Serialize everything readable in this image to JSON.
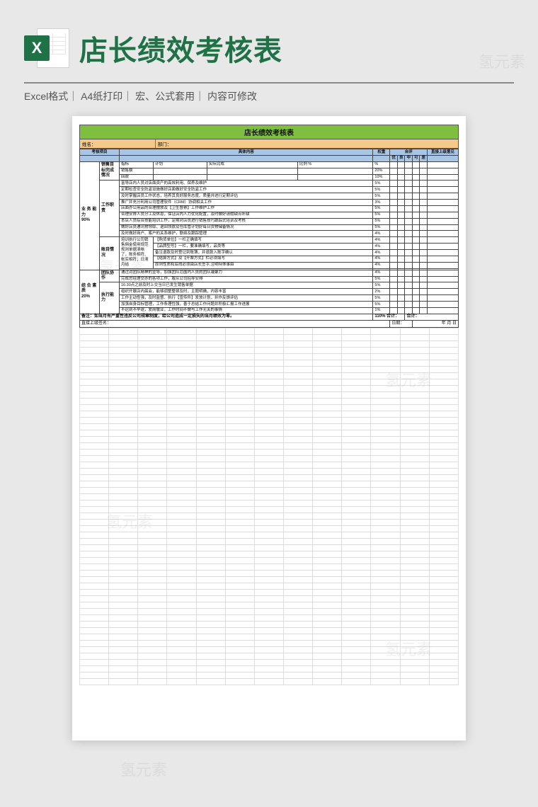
{
  "header": {
    "title": "店长绩效考核表",
    "excel_letter": "X"
  },
  "meta": {
    "line": "Excel格式｜  A4纸打印｜ 宏、公式套用｜ 内容可修改"
  },
  "sheet": {
    "title": "店长绩效考核表",
    "name_label": "姓名：",
    "dept_label": "部门：",
    "col": {
      "item": "考核项目",
      "content": "具体内容",
      "weight": "权重",
      "self": "自评",
      "self_sub": [
        "优",
        "良",
        "中",
        "可",
        "差"
      ],
      "supervisor": "直接上级意见"
    },
    "cat1": {
      "label": "业 务 能 力",
      "weight": "90%"
    },
    "cat2": {
      "label": "综 合 素 质",
      "weight": "20%"
    },
    "g1": {
      "label": "销售目标完成情况",
      "r1a": "指标",
      "r1b": "计划",
      "r1c": "实际完成",
      "r1d": "比例 %",
      "r1w": "%",
      "r2": "销售额",
      "r2w": "20%",
      "r3": "回款",
      "r3w": "10%"
    },
    "g2": {
      "label": "工作职责",
      "rows": [
        {
          "t": "富导店内人员对店面资产的高效利用、保养及维护",
          "w": "5%"
        },
        {
          "t": "定期检查安全防盗设施做好店面做好安全防盗工作",
          "w": "5%"
        },
        {
          "t": "及时掌握店员工作状态，培养其良好服务态度、质量并进行定期评估",
          "w": "5%"
        },
        {
          "t": "推广并充分利用公司管理软件（CRM）协调相关工作",
          "w": "3%"
        },
        {
          "t": "店面办公用品的合理摆放及【卫生督察】工作维护工作",
          "w": "5%"
        },
        {
          "t": "合理安排人员分工及休息，保证店内人力优化配置，及时做好请假缺点补缺",
          "w": "5%"
        },
        {
          "t": "本店人员综合技能培训工作，定期对店员进行销售技巧跟踪式培训及考核",
          "w": "5%"
        },
        {
          "t": "做好店员通讯物领取、退回领款及仓库管计划好每日货物储备情况",
          "w": "5%"
        },
        {
          "t": "及时做好商户、客户的关系维护，联络及跟踪管理",
          "w": "4%"
        }
      ]
    },
    "g3": {
      "label": "账目情况",
      "rows": [
        {
          "t": "培训执行公司销售佣金使用规范规则单据清晰了，账务相符、帐实相符；日清月结",
          "w": ""
        },
        {
          "t1": "【购货单位】一栏正确填写",
          "w": "4%"
        },
        {
          "t1": "【品牌型号】一栏，要准确填写，品类等",
          "w": "4%"
        },
        {
          "t1": "备注退款及时登记到账簿，并退款入账字确认",
          "w": "4%"
        },
        {
          "t1": "【结算方式】及【开票方式】栏必须填写",
          "w": "4%"
        },
        {
          "t1": "原则性质和底线必须由店长签字,注明特殊事由",
          "w": "4%"
        }
      ]
    },
    "g4": {
      "label": "团队协作",
      "rows": [
        {
          "t": "通过对团队精神的宣导，加强团队范围内人员的团队凝聚力",
          "w": "4%"
        },
        {
          "t": "完成总经理交办的各项工作，服从公司招导安排",
          "w": "5%"
        }
      ]
    },
    "g5": {
      "label": "执行能力",
      "rows": [
        {
          "t": "16:30点之前及时上交当日已发生销售单据",
          "w": "5%"
        },
        {
          "t": "组织开展店内晨会，能够调整整顿及时，主题明确，内容丰富",
          "w": "2%"
        },
        {
          "t": "工作主动性强，及时监督、执行【宣传件】发放计划，并作反馈评估",
          "w": "5%"
        },
        {
          "t": "加强自身目标管理，工作条理性强，善于总结工作问题并积极汇报工作进展",
          "w": "5%"
        },
        {
          "t": "不迟到不早退，爱岗敬业，工作时间不做与工作无关的事情",
          "w": "1%"
        }
      ]
    },
    "note": "备注：如当月有严重性违反公司规章制度，给公司造成一定损失的当月绩效为零。",
    "total_label": "110% 合计：",
    "total_label2": "合计：",
    "sign_label": "直接上级签名：",
    "date_label": "日期：",
    "date_ymd": "年    月    日"
  },
  "watermark": "氢元素"
}
